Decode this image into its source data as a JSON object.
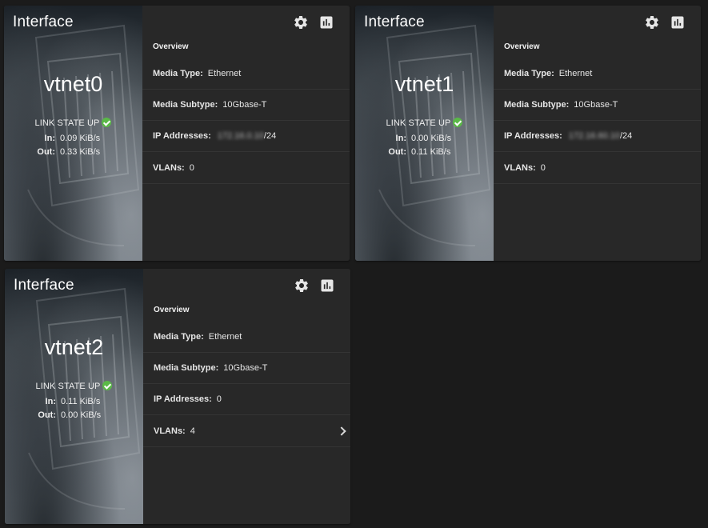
{
  "cards": [
    {
      "title": "Interface",
      "name": "vtnet0",
      "link_state": "LINK STATE UP",
      "in_label": "In:",
      "in_value": "0.09 KiB/s",
      "out_label": "Out:",
      "out_value": "0.33 KiB/s",
      "overview_label": "Overview",
      "media_type_label": "Media Type:",
      "media_type": "Ethernet",
      "media_subtype_label": "Media Subtype:",
      "media_subtype": "10Gbase-T",
      "ip_label": "IP Addresses:",
      "ip_blurred": "172.16.0.10",
      "ip_suffix": "/24",
      "vlans_label": "VLANs:",
      "vlans": "0"
    },
    {
      "title": "Interface",
      "name": "vtnet1",
      "link_state": "LINK STATE UP",
      "in_label": "In:",
      "in_value": "0.00 KiB/s",
      "out_label": "Out:",
      "out_value": "0.11 KiB/s",
      "overview_label": "Overview",
      "media_type_label": "Media Type:",
      "media_type": "Ethernet",
      "media_subtype_label": "Media Subtype:",
      "media_subtype": "10Gbase-T",
      "ip_label": "IP Addresses:",
      "ip_blurred": "172.16.60.10",
      "ip_suffix": "/24",
      "vlans_label": "VLANs:",
      "vlans": "0"
    },
    {
      "title": "Interface",
      "name": "vtnet2",
      "link_state": "LINK STATE UP",
      "in_label": "In:",
      "in_value": "0.11 KiB/s",
      "out_label": "Out:",
      "out_value": "0.00 KiB/s",
      "overview_label": "Overview",
      "media_type_label": "Media Type:",
      "media_type": "Ethernet",
      "media_subtype_label": "Media Subtype:",
      "media_subtype": "10Gbase-T",
      "ip_label": "IP Addresses:",
      "ip_value": "0",
      "vlans_label": "VLANs:",
      "vlans": "4"
    }
  ],
  "icons": {
    "settings": "gear-icon",
    "reports": "bar-chart-icon",
    "link_up": "check-circle-icon",
    "vlans_expand": "chevron-right-icon"
  },
  "colors": {
    "background": "#1b1b1b",
    "card": "#282828",
    "link_up_green": "#5ab947"
  }
}
